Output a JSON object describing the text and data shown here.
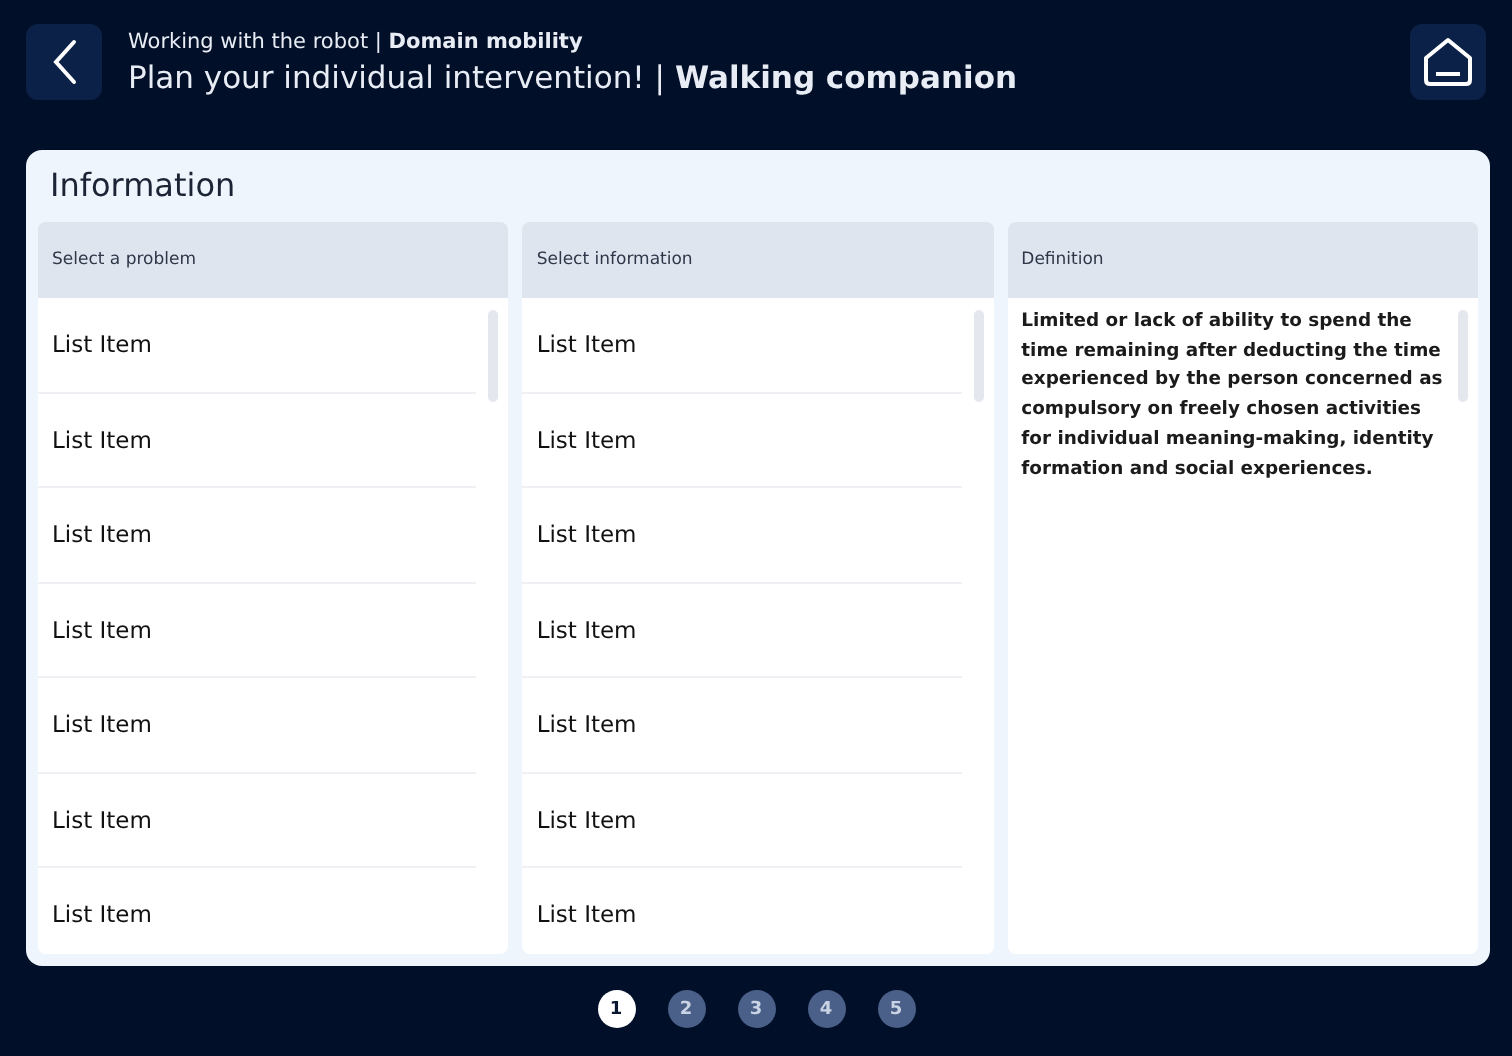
{
  "header": {
    "subtitle": "Working with the robot | **Domain mobility**",
    "title": "Plan your individual intervention! | **Walking companion**"
  },
  "panel": {
    "title": "Information",
    "columns": [
      {
        "kind": "list",
        "heading": "Select a problem",
        "items": [
          "List Item",
          "List Item",
          "List Item",
          "List Item",
          "List Item",
          "List Item",
          "List Item"
        ]
      },
      {
        "kind": "list",
        "heading": "Select information",
        "items": [
          "List Item",
          "List Item",
          "List Item",
          "List Item",
          "List Item",
          "List Item",
          "List Item"
        ]
      },
      {
        "kind": "text",
        "heading": "Definition",
        "text": "Limited or lack of ability to spend the time remaining after deducting the time experienced by the person concerned as compulsory on freely chosen activities for individual meaning-making, identity formation and social experiences."
      }
    ]
  },
  "pager": [
    {
      "label": "1",
      "selected": true
    },
    {
      "label": "2",
      "selected": false
    },
    {
      "label": "3",
      "selected": false
    },
    {
      "label": "4",
      "selected": false
    },
    {
      "label": "5",
      "selected": false
    }
  ]
}
